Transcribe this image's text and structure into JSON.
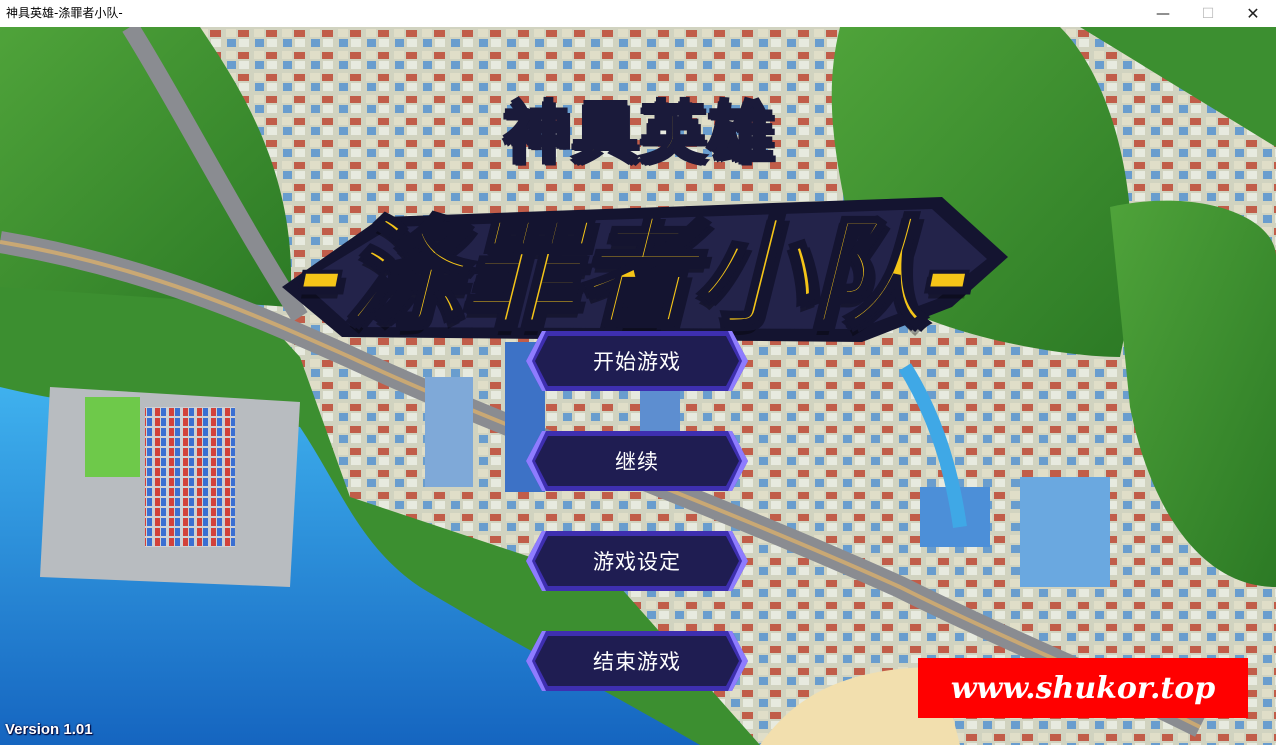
{
  "window": {
    "title": "神具英雄-涤罪者小队-",
    "minimize_glyph": "—",
    "maximize_glyph": "☐",
    "close_glyph": "✕"
  },
  "logo": {
    "line1": "神具英雄",
    "line2": "-涤罪者小队-"
  },
  "menu": {
    "start": "开始游戏",
    "continue": "继续",
    "settings": "游戏设定",
    "quit": "结束游戏"
  },
  "version": "Version 1.01",
  "watermark": "www.shukor.top",
  "colors": {
    "button_fill": "#1f1d52",
    "button_border": "#5d4bd6",
    "logo_yellow": "#f5c518",
    "sea": "#1f8fd6",
    "watermark_red": "#ff0000"
  }
}
